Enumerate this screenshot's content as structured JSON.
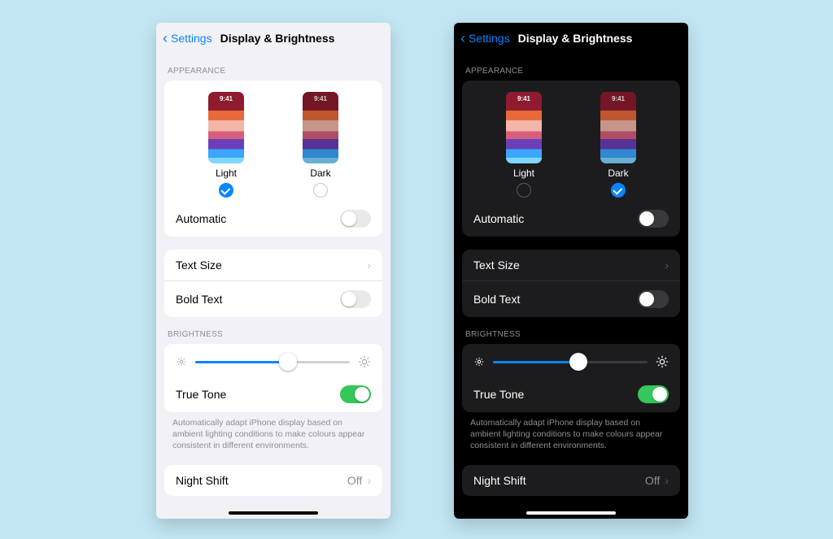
{
  "nav": {
    "back_label": "Settings",
    "title": "Display & Brightness"
  },
  "sections": {
    "appearance_header": "APPEARANCE",
    "brightness_header": "BRIGHTNESS"
  },
  "appearance": {
    "thumb_time": "9:41",
    "light_label": "Light",
    "dark_label": "Dark",
    "automatic_label": "Automatic"
  },
  "rows": {
    "text_size": "Text Size",
    "bold_text": "Bold Text",
    "true_tone": "True Tone",
    "night_shift": "Night Shift",
    "night_shift_value": "Off"
  },
  "footnote": "Automatically adapt iPhone display based on ambient lighting conditions to make colours appear consistent in different environments.",
  "light_panel": {
    "selected_mode": "light",
    "automatic_on": false,
    "bold_text_on": false,
    "true_tone_on": true,
    "brightness_pct": 60
  },
  "dark_panel": {
    "selected_mode": "dark",
    "automatic_on": false,
    "bold_text_on": false,
    "true_tone_on": true,
    "brightness_pct": 55
  }
}
